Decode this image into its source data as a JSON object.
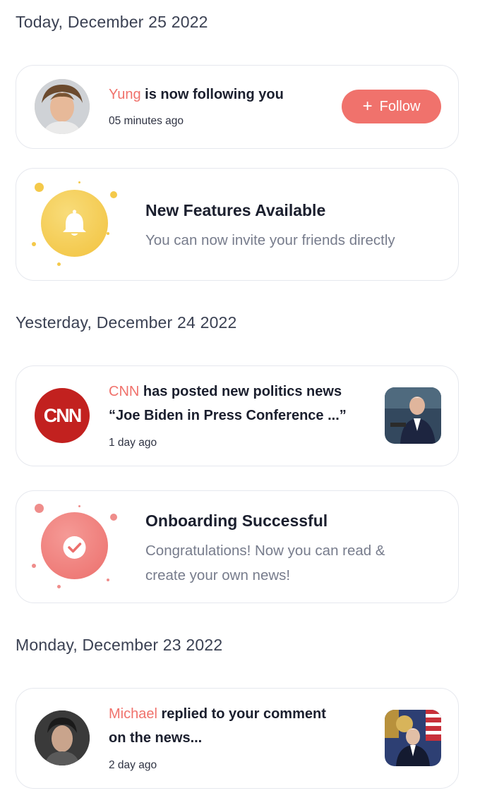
{
  "sections": [
    {
      "date": "Today, December 25 2022"
    },
    {
      "date": "Yesterday, December 24 2022"
    },
    {
      "date": "Monday, December 23 2022"
    }
  ],
  "notifications": {
    "follow": {
      "actor": "Yung",
      "text": " is now following you",
      "time": "05 minutes ago",
      "button_plus": "+",
      "button_label": "Follow"
    },
    "features": {
      "title": "New Features Available",
      "subtitle": "You can now invite your friends directly"
    },
    "cnn": {
      "actor": "CNN",
      "text": " has posted new politics news",
      "line2": "“Joe Biden in Press Conference ...”",
      "time": "1 day ago",
      "logo_text": "CNN"
    },
    "onboarding": {
      "title": "Onboarding Successful",
      "subtitle_line1": "Congratulations! Now you can read &",
      "subtitle_line2": "create your own news!"
    },
    "reply": {
      "actor": "Michael",
      "text": " replied to your comment",
      "line2": "on the news...",
      "time": "2 day ago"
    }
  },
  "colors": {
    "accent": "#f0726c",
    "bell": "#f4c94a",
    "check": "#ef7d7a"
  }
}
